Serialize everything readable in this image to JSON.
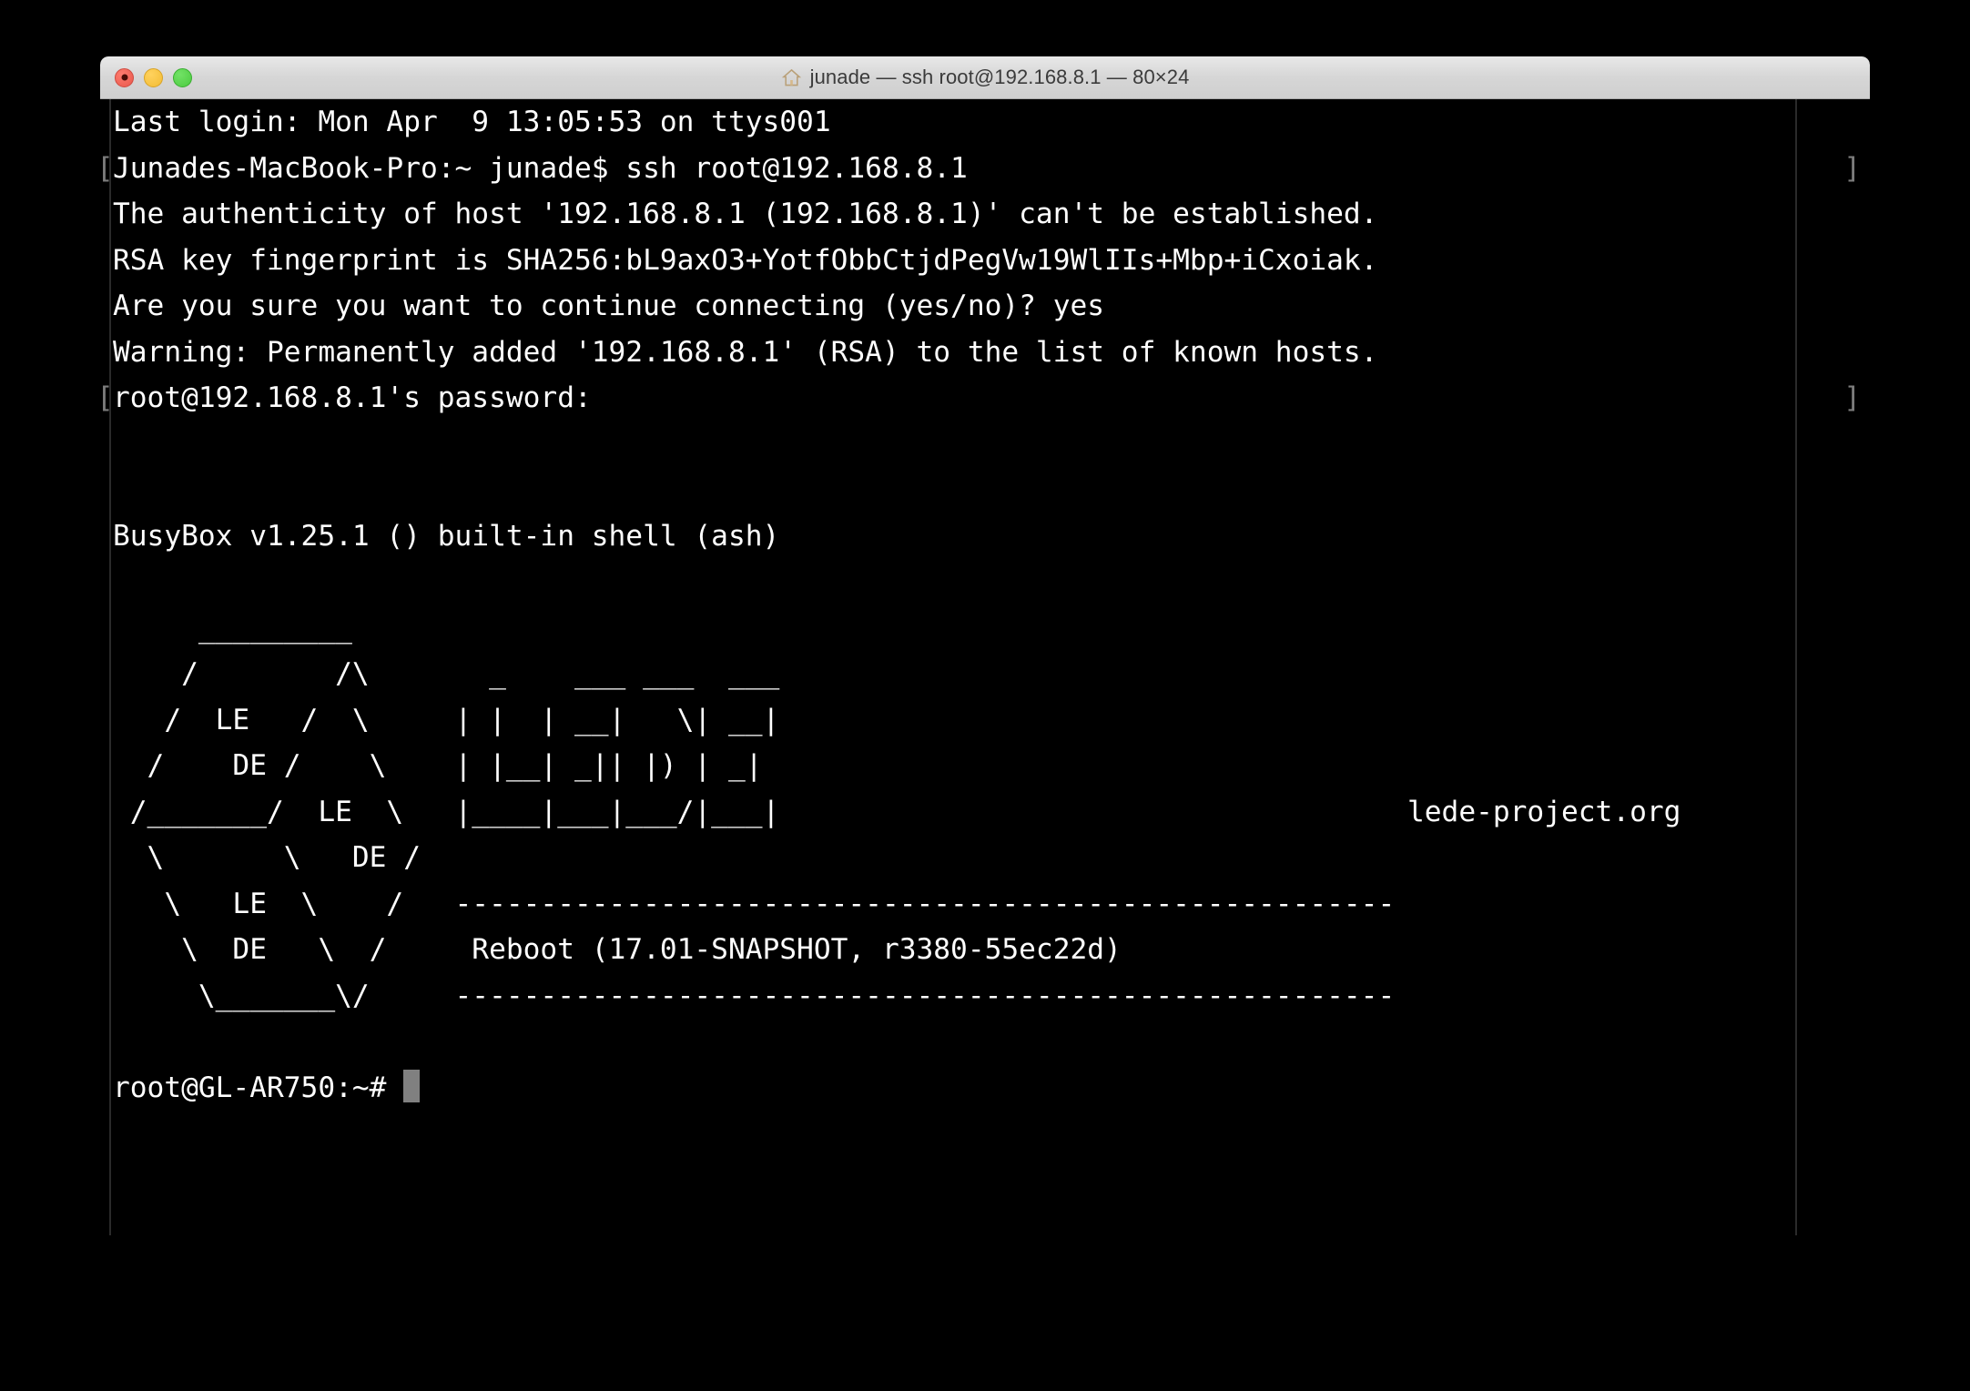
{
  "window": {
    "title": "junade — ssh root@192.168.8.1 — 80×24",
    "icon": "house-icon",
    "size_label": "80×24",
    "controls": {
      "close": "close-button",
      "minimize": "minimize-button",
      "maximize": "maximize-button"
    }
  },
  "theme": {
    "background": "#000000",
    "foreground": "#ffffff",
    "titlebar": "#d6d6d6",
    "title_text": "#3b3b3b",
    "prompt_mark": "#7d7d7d",
    "cursor": "#808080",
    "close_light": "#e8594d",
    "minimize_light": "#f3bc34",
    "maximize_light": "#4ccb40"
  },
  "terminal": {
    "prompt_marker_open": "[",
    "prompt_marker_close": "]",
    "cursor_glyph": "block-cursor",
    "lines": [
      {
        "text": "Last login: Mon Apr  9 13:05:53 on ttys001",
        "mark": ""
      },
      {
        "text": "Junades-MacBook-Pro:~ junade$ ssh root@192.168.8.1",
        "mark": "both"
      },
      {
        "text": "The authenticity of host '192.168.8.1 (192.168.8.1)' can't be established.",
        "mark": ""
      },
      {
        "text": "RSA key fingerprint is SHA256:bL9axO3+YotfObbCtjdPegVw19WlIIs+Mbp+iCxoiak.",
        "mark": ""
      },
      {
        "text": "Are you sure you want to continue connecting (yes/no)? yes",
        "mark": ""
      },
      {
        "text": "Warning: Permanently added '192.168.8.1' (RSA) to the list of known hosts.",
        "mark": ""
      },
      {
        "text": "root@192.168.8.1's password: ",
        "mark": "both"
      },
      {
        "text": "",
        "mark": ""
      },
      {
        "text": "",
        "mark": ""
      },
      {
        "text": "BusyBox v1.25.1 () built-in shell (ash)",
        "mark": ""
      },
      {
        "text": "",
        "mark": ""
      },
      {
        "text": "   _________",
        "mark": ""
      },
      {
        "text": "  /        /\\      _    ___ ___  ___",
        "mark": ""
      },
      {
        "text": " /  LE   /  \\    | |  | __|   \\| __|",
        "mark": ""
      },
      {
        "text": "/    DE /    \\   | |__| _|| |) | _|",
        "mark": ""
      },
      {
        "text": "/_______/  LE  \\  |____|___|___/|___|",
        "mark": ""
      },
      {
        "text": "\\       \\   DE /",
        "mark": ""
      },
      {
        "text": " \\   LE  \\   /   -------------------------------------------------------",
        "mark": ""
      },
      {
        "text": "  \\  DE   \\ /     Reboot (17.01-SNAPSHOT, r3380-55ec22d)",
        "mark": ""
      },
      {
        "text": "   \\_______\\/     -------------------------------------------------------",
        "mark": ""
      },
      {
        "text": "",
        "mark": ""
      },
      {
        "text": "root@GL-AR750:~# ",
        "mark": ""
      }
    ],
    "ascii_art": {
      "project_url": "lede-project.org",
      "build_line": "Reboot (17.01-SNAPSHOT, r3380-55ec22d)",
      "separator": "-------------------------------------------------------",
      "logo_words": [
        "LE",
        "DE",
        "LE",
        "DE",
        "LE",
        "DE"
      ],
      "banner_word": "LEDE"
    },
    "prompt": {
      "user_host": "root@GL-AR750",
      "path": "~",
      "symbol": "#"
    },
    "session": {
      "last_login": "Last login: Mon Apr  9 13:05:53 on ttys001",
      "local_prompt": "Junades-MacBook-Pro:~ junade$",
      "command": "ssh root@192.168.8.1",
      "host_ip": "192.168.8.1",
      "fingerprint": "SHA256:bL9axO3+YotfObbCtjdPegVw19WlIIs+Mbp+iCxoiak.",
      "answer": "yes",
      "busybox_version": "BusyBox v1.25.1 () built-in shell (ash)"
    }
  }
}
